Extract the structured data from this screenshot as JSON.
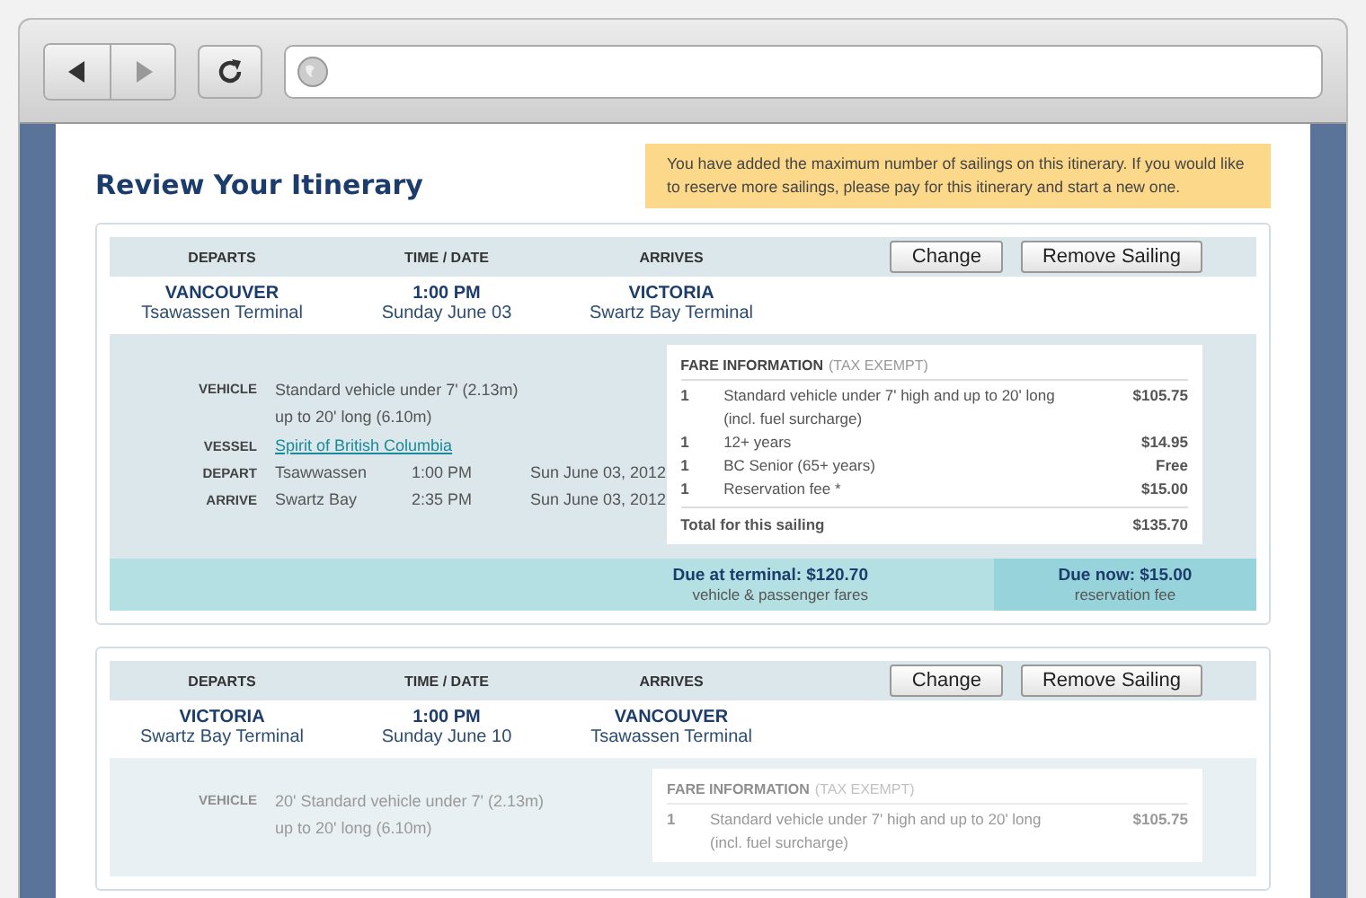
{
  "page": {
    "title": "Review Your Itinerary",
    "notice": "You have added the maximum number of sailings on this itinerary. If you would like to reserve more sailings, please pay for this itinerary and start a new one."
  },
  "sailings": [
    {
      "faded": false,
      "columns": [
        "DEPARTS",
        "TIME / DATE",
        "ARRIVES"
      ],
      "buttons": [
        "Change",
        "Remove Sailing"
      ],
      "summary": [
        {
          "main": "VANCOUVER",
          "sub": "Tsawassen Terminal"
        },
        {
          "main": "1:00 PM",
          "sub": "Sunday June 03"
        },
        {
          "main": "VICTORIA",
          "sub": "Swartz Bay Terminal"
        }
      ],
      "details": [
        {
          "kind": "text",
          "label": "VEHICLE",
          "lines": [
            "Standard vehicle under 7' (2.13m)",
            "up to 20' long (6.10m)"
          ]
        },
        {
          "kind": "link",
          "label": "VESSEL",
          "lines": [
            "Spirit of British Columbia"
          ]
        },
        {
          "kind": "stop",
          "label": "DEPART",
          "lines": [
            "Tsawwassen",
            "1:00 PM",
            "Sun June 03, 2012"
          ]
        },
        {
          "kind": "stop",
          "label": "ARRIVE",
          "lines": [
            "Swartz Bay",
            "2:35 PM",
            "Sun June 03, 2012"
          ]
        }
      ],
      "fare": {
        "title": "FARE INFORMATION",
        "note": "(TAX EXEMPT)",
        "items": [
          {
            "qty": "1",
            "lines": [
              "Standard vehicle under 7' high and up to 20' long",
              "(incl. fuel surcharge)"
            ],
            "price": "$105.75"
          },
          {
            "qty": "1",
            "lines": [
              "12+ years"
            ],
            "price": "$14.95"
          },
          {
            "qty": "1",
            "lines": [
              "BC Senior (65+ years)"
            ],
            "price": "Free"
          },
          {
            "qty": "1",
            "lines": [
              "Reservation fee *"
            ],
            "price": "$15.00"
          }
        ],
        "total_label": "Total for this sailing",
        "total": "$135.70"
      },
      "due": {
        "terminal": "Due at terminal: $120.70",
        "terminal_note": "vehicle & passenger fares",
        "now": "Due now: $15.00",
        "now_note": "reservation fee"
      }
    },
    {
      "faded": true,
      "columns": [
        "DEPARTS",
        "TIME / DATE",
        "ARRIVES"
      ],
      "buttons": [
        "Change",
        "Remove Sailing"
      ],
      "summary": [
        {
          "main": "VICTORIA",
          "sub": "Swartz Bay Terminal"
        },
        {
          "main": "1:00 PM",
          "sub": "Sunday June 10"
        },
        {
          "main": "VANCOUVER",
          "sub": "Tsawassen Terminal"
        }
      ],
      "details": [
        {
          "kind": "text",
          "label": "VEHICLE",
          "lines": [
            "20' Standard vehicle under 7' (2.13m)",
            "up to 20' long (6.10m)"
          ]
        }
      ],
      "fare": {
        "title": "FARE INFORMATION",
        "note": "(TAX EXEMPT)",
        "items": [
          {
            "qty": "1",
            "lines": [
              "Standard vehicle under 7' high and up to 20' long",
              "(incl. fuel surcharge)"
            ],
            "price": "$105.75"
          }
        ]
      }
    }
  ]
}
